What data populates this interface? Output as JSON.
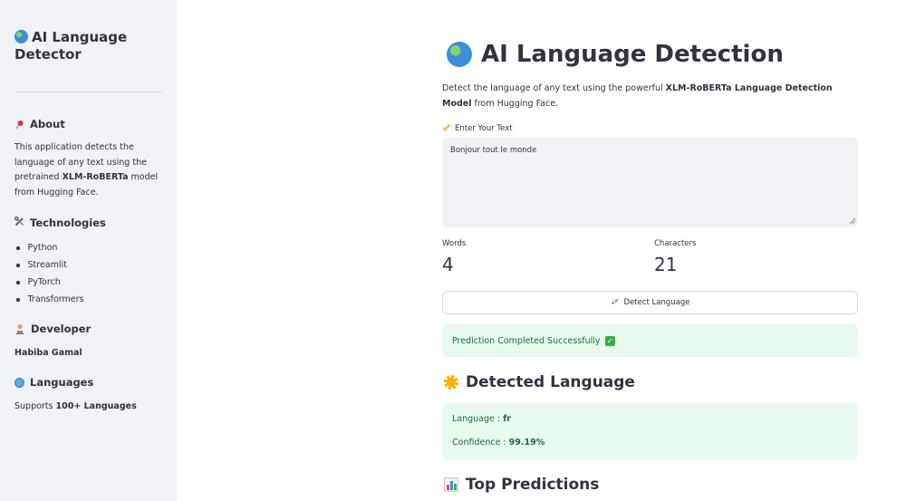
{
  "sidebar": {
    "title": "AI Language Detector",
    "about": {
      "heading": "About",
      "text_before": "This application detects the language of any text using the pretrained ",
      "text_strong": "XLM-RoBERTa",
      "text_after": " model from Hugging Face."
    },
    "technologies": {
      "heading": "Technologies",
      "items": [
        "Python",
        "Streamlit",
        "PyTorch",
        "Transformers"
      ]
    },
    "developer": {
      "heading": "Developer",
      "name": "Habiba Gamal"
    },
    "languages": {
      "heading": "Languages",
      "text_before": "Supports ",
      "text_strong": "100+ Languages"
    }
  },
  "main": {
    "title": "AI Language Detection",
    "description_before": "Detect the language of any text using the powerful ",
    "description_strong": "XLM-RoBERTa Language Detection Model",
    "description_after": " from Hugging Face.",
    "input_label": "Enter Your Text",
    "input_value": "Bonjour tout le monde",
    "metrics": {
      "words_label": "Words",
      "words_value": "4",
      "chars_label": "Characters",
      "chars_value": "21"
    },
    "detect_button": "Detect Language",
    "success_message": "Prediction Completed Successfully",
    "detected_heading": "Detected Language",
    "result": {
      "language_label": "Language : ",
      "language_value": "fr",
      "confidence_label": "Confidence : ",
      "confidence_value": "99.19%"
    },
    "top_heading": "Top Predictions"
  },
  "colors": {
    "sidebar_bg": "#f0f2f6",
    "success_bg": "#e8f9ee",
    "success_text": "#177233"
  }
}
